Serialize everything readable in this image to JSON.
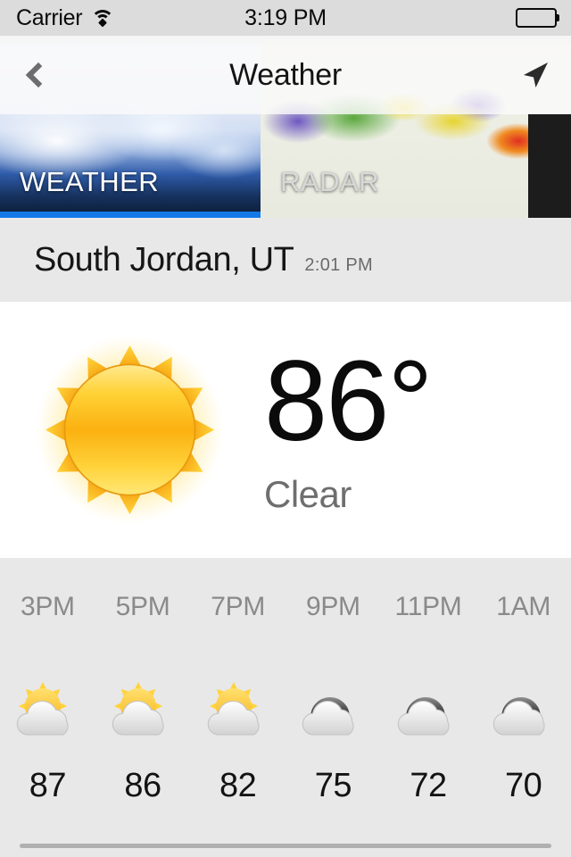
{
  "status_bar": {
    "carrier": "Carrier",
    "wifi_icon": "wifi-icon",
    "time": "3:19 PM",
    "battery_icon": "battery-full-icon"
  },
  "nav_bar": {
    "back_icon": "chevron-left-icon",
    "title": "Weather",
    "location_icon": "navigation-arrow-icon"
  },
  "tabs": [
    {
      "label": "WEATHER",
      "active": true
    },
    {
      "label": "RADAR",
      "active": false
    }
  ],
  "location": {
    "name": "South Jordan, UT",
    "observed_time": "2:01 PM"
  },
  "current": {
    "icon": "sun-icon",
    "temperature": "86°",
    "condition": "Clear"
  },
  "hourly": {
    "times": [
      "3PM",
      "5PM",
      "7PM",
      "9PM",
      "11PM",
      "1AM"
    ],
    "icons": [
      "partly-cloudy-day-icon",
      "partly-cloudy-day-icon",
      "partly-cloudy-day-icon",
      "cloudy-night-icon",
      "cloudy-night-icon",
      "cloudy-night-icon"
    ],
    "temps": [
      "87",
      "86",
      "82",
      "75",
      "72",
      "70"
    ]
  },
  "colors": {
    "accent_blue": "#1479e8",
    "page_background": "#e8e8e8",
    "card_background": "#ffffff",
    "sun_yellow": "#ffd63d",
    "sun_orange": "#f9a825"
  }
}
